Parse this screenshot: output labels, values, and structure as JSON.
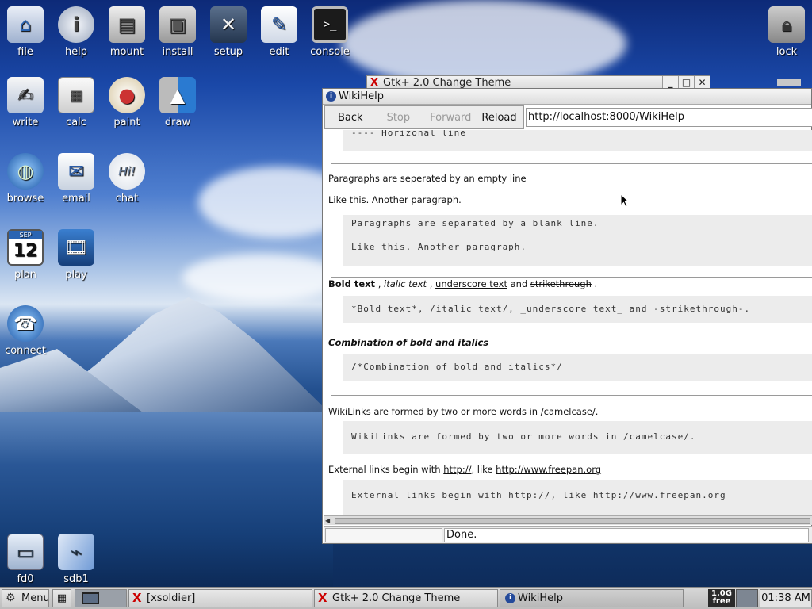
{
  "desktop": {
    "icons": [
      {
        "label": "file"
      },
      {
        "label": "help"
      },
      {
        "label": "mount"
      },
      {
        "label": "install"
      },
      {
        "label": "setup"
      },
      {
        "label": "edit"
      },
      {
        "label": "console"
      },
      {
        "label": "lock"
      },
      {
        "label": "write"
      },
      {
        "label": "calc"
      },
      {
        "label": "paint"
      },
      {
        "label": "draw"
      },
      {
        "label": "browse"
      },
      {
        "label": "email"
      },
      {
        "label": "chat"
      },
      {
        "label": "plan"
      },
      {
        "label": "play"
      },
      {
        "label": "connect"
      },
      {
        "label": "fd0"
      },
      {
        "label": "sdb1"
      }
    ],
    "calendar_day": "12",
    "calendar_month": "SEP"
  },
  "gtk_window": {
    "title": "Gtk+ 2.0 Change Theme"
  },
  "wiki_window": {
    "title": "WikiHelp",
    "toolbar": {
      "back": "Back",
      "stop": "Stop",
      "forward": "Forward",
      "reload": "Reload"
    },
    "url": "http://localhost:8000/WikiHelp",
    "content": {
      "hr_code": "---- Horizonal line",
      "para_intro": "Paragraphs are seperated by an empty line",
      "para_example": "Like this. Another paragraph.",
      "code_para1": "Paragraphs are separated by a blank line.",
      "code_para2": "Like this. Another paragraph.",
      "bold_text": "Bold text",
      "sep1": " , ",
      "italic_text": "italic text",
      "sep2": " , ",
      "underscore_text": "underscore text",
      "and_text": " and ",
      "strike_text": "strikethrough",
      "end_dot": " .",
      "code_formatting": "*Bold text*, /italic text/, _underscore text_ and -strikethrough-.",
      "bold_italic": "Combination of bold and italics",
      "code_bold_italic": "/*Combination of bold and italics*/",
      "wikilinks_link": "WikiLinks",
      "wikilinks_rest": " are formed by two or more words in /camelcase/.",
      "code_wikilinks": "WikiLinks are formed by two or more words in /camelcase/.",
      "ext_pre": "External links begin with ",
      "ext_http": "http://",
      "ext_mid": ", like ",
      "ext_url": "http://www.freepan.org",
      "code_ext": "External links begin with http://, like http://www.freepan.org"
    },
    "status": "Done."
  },
  "taskbar": {
    "menu": "Menu",
    "tasks": [
      {
        "label": "[xsoldier]"
      },
      {
        "label": "Gtk+ 2.0 Change Theme"
      },
      {
        "label": "WikiHelp"
      }
    ],
    "mem_top": "1.0G",
    "mem_bottom": "free",
    "clock": "01:38 AM"
  }
}
